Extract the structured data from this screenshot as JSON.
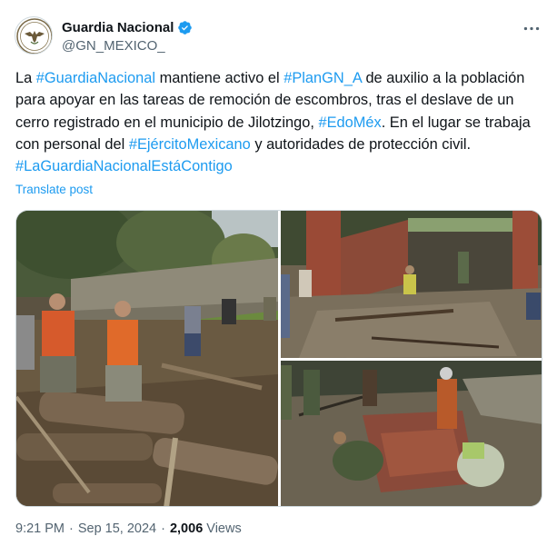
{
  "author": {
    "display_name": "Guardia Nacional",
    "handle": "@GN_MEXICO_",
    "verified": true,
    "avatar_icon": "guardia-nacional-eagle-emblem"
  },
  "more_icon": "more-horizontal-icon",
  "tweet": {
    "segments": [
      {
        "text": "La ",
        "hashtag": false
      },
      {
        "text": "#GuardiaNacional",
        "hashtag": true
      },
      {
        "text": " mantiene activo el ",
        "hashtag": false
      },
      {
        "text": "#PlanGN_A",
        "hashtag": true
      },
      {
        "text": " de auxilio a la población para apoyar en las tareas de remoción de escombros, tras el deslave de un cerro registrado en el municipio de Jilotzingo, ",
        "hashtag": false
      },
      {
        "text": "#EdoMéx",
        "hashtag": true
      },
      {
        "text": ". En el lugar se trabaja con personal del ",
        "hashtag": false
      },
      {
        "text": "#EjércitoMexicano",
        "hashtag": true
      },
      {
        "text": " y autoridades de protección civil. ",
        "hashtag": false
      },
      {
        "text": "#LaGuardiaNacionalEstáContigo",
        "hashtag": true
      }
    ],
    "translate_label": "Translate post"
  },
  "meta": {
    "time": "9:21 PM",
    "separator": "·",
    "date": "Sep 15, 2024",
    "separator2": "·",
    "views_count": "2,006",
    "views_label": "Views"
  },
  "colors": {
    "text": "#0f1419",
    "secondary": "#536471",
    "accent": "#1d9bf0"
  }
}
